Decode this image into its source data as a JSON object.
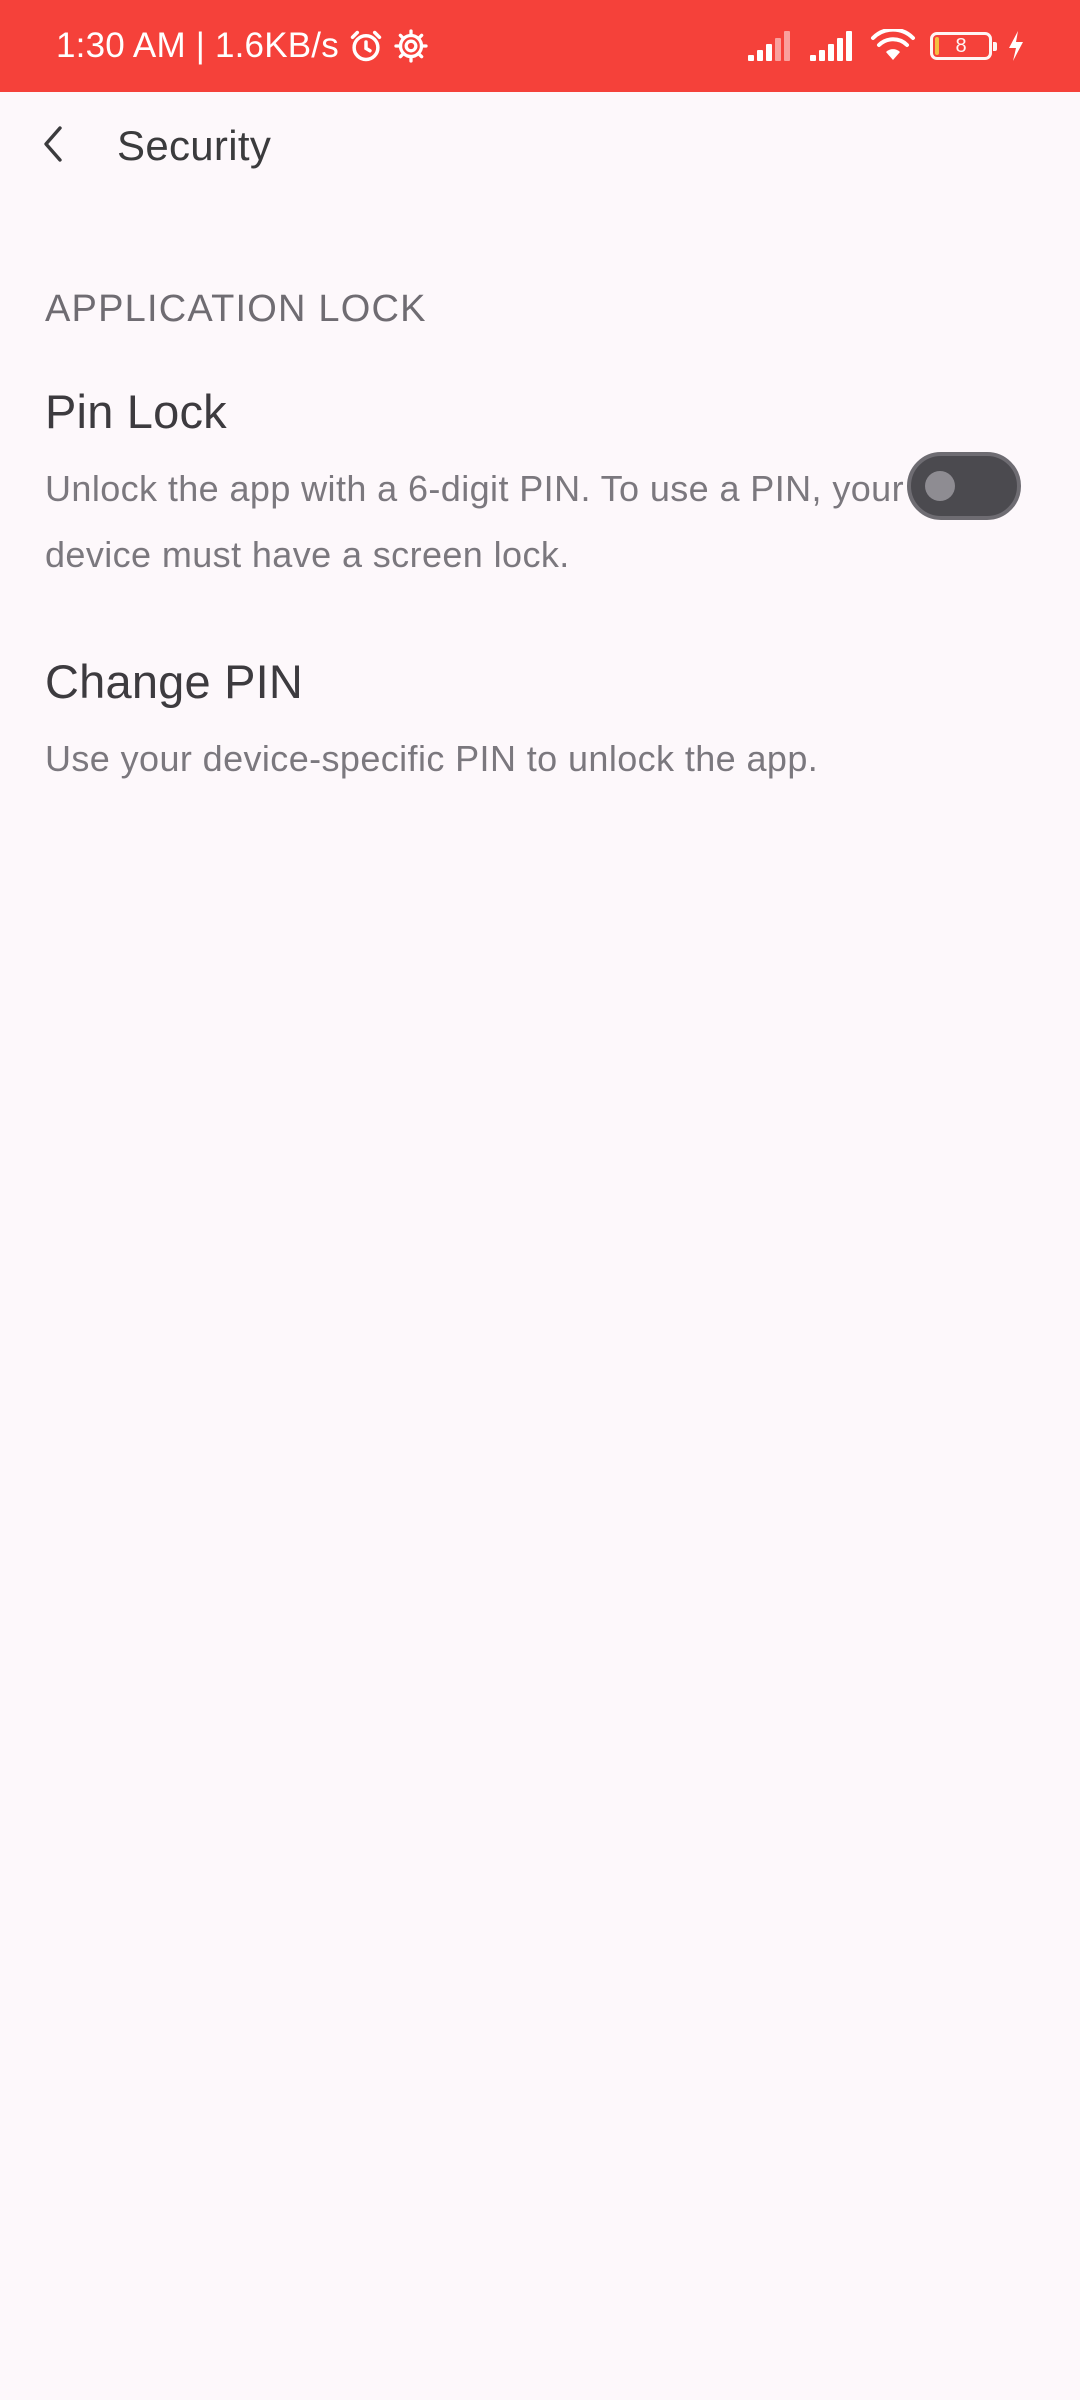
{
  "status_bar": {
    "time_speed": "1:30 AM | 1.6KB/s",
    "left_icons": [
      "alarm-icon",
      "settings-gear-icon"
    ],
    "right_icons": [
      "signal-1-icon",
      "signal-2-icon",
      "wifi-icon",
      "battery-icon",
      "charging-icon"
    ],
    "battery_level": "8",
    "background": "#f5413a"
  },
  "app_bar": {
    "back_icon": "chevron-left-icon",
    "title": "Security"
  },
  "section": {
    "header": "APPLICATION LOCK"
  },
  "preferences": {
    "pin_lock": {
      "title": "Pin Lock",
      "summary": "Unlock the app with a 6-digit PIN. To use a PIN, your device must have a screen lock.",
      "enabled": false
    },
    "change_pin": {
      "title": "Change PIN",
      "summary": "Use your device-specific PIN to unlock the app."
    }
  },
  "colors": {
    "page_background": "#fdf8fb",
    "title_text": "#3d3b3f",
    "summary_text": "#7b787e",
    "switch_track_off": "#4b4a4f"
  }
}
